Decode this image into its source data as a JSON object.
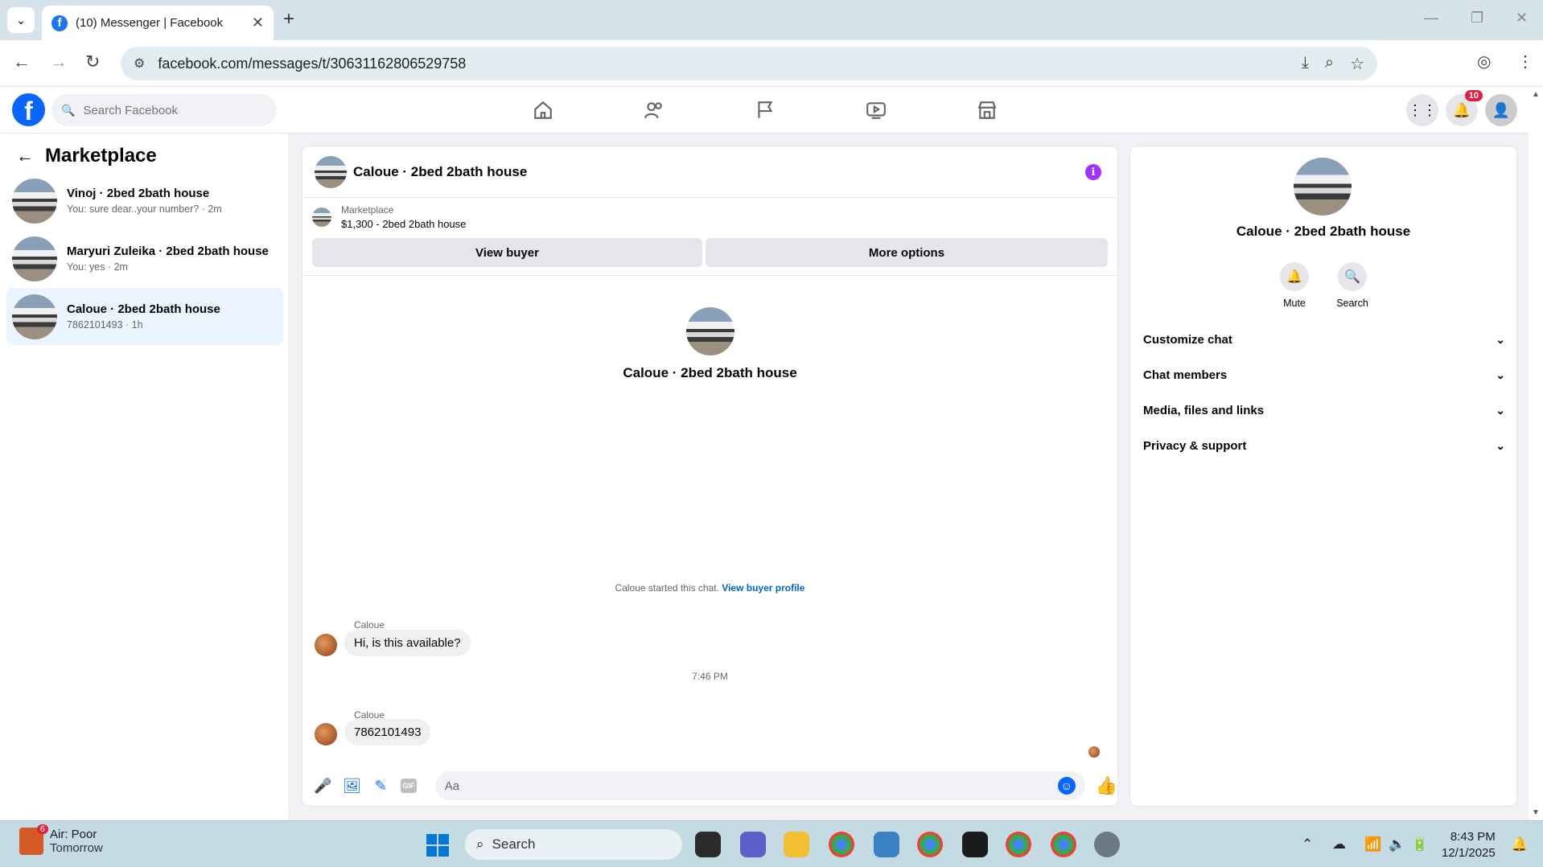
{
  "browser": {
    "tab_title": "(10) Messenger | Facebook",
    "url": "facebook.com/messages/t/30631162806529758"
  },
  "fb": {
    "search_placeholder": "Search Facebook",
    "notif_count": "10"
  },
  "left": {
    "heading": "Marketplace",
    "conversations": [
      {
        "name": "Vinoj · 2bed 2bath house",
        "snippet": "You: sure dear..your number? · 2m"
      },
      {
        "name": "Maryuri Zuleika · 2bed 2bath house",
        "snippet": "You: yes · 2m"
      },
      {
        "name": "Caloue · 2bed 2bath house",
        "snippet": "7862101493 · 1h"
      }
    ]
  },
  "chat": {
    "title": "Caloue · 2bed 2bath house",
    "listing_source": "Marketplace",
    "listing_price": "$1,300 - 2bed 2bath house",
    "view_buyer": "View buyer",
    "more_options": "More options",
    "profile_name": "Caloue · 2bed 2bath house",
    "started_text": "Caloue started this chat.",
    "started_link": "View buyer profile",
    "messages": [
      {
        "sender": "Caloue",
        "text": "Hi, is this available?"
      },
      {
        "sender": "Caloue",
        "text": "7862101493"
      }
    ],
    "timestamp": "7:46 PM",
    "composer_placeholder": "Aa",
    "gif_label": "GIF"
  },
  "right": {
    "name": "Caloue · 2bed 2bath house",
    "actions": [
      "Mute",
      "Search"
    ],
    "sections": [
      "Customize chat",
      "Chat members",
      "Media, files and links",
      "Privacy & support"
    ]
  },
  "taskbar": {
    "weather_badge": "6",
    "weather_line1": "Air: Poor",
    "weather_line2": "Tomorrow",
    "search_label": "Search",
    "time": "8:43 PM",
    "date": "12/1/2025"
  }
}
